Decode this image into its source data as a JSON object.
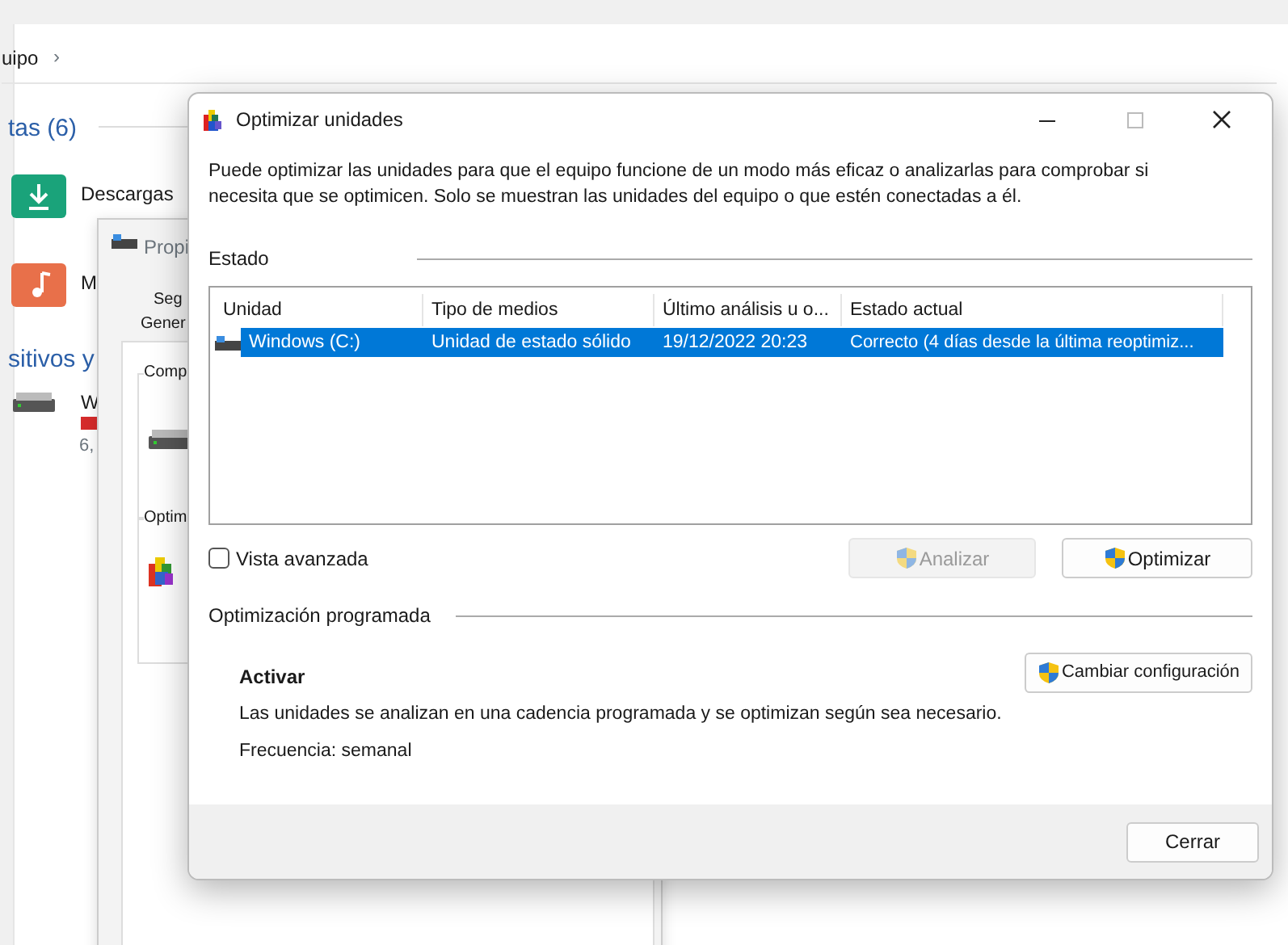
{
  "explorer": {
    "breadcrumb": "uipo",
    "breadcrumb_arrow": "›",
    "folders_heading": "tas (6)",
    "folders": [
      {
        "label": "Descargas",
        "kind": "downloads"
      },
      {
        "label": "M",
        "kind": "music"
      }
    ],
    "devices_heading": "sitivos y",
    "drive": {
      "label": "W",
      "size": "6,"
    }
  },
  "properties_window": {
    "title": "Propi",
    "tabs": [
      "Seg",
      "Gener"
    ],
    "groups": [
      "Comp",
      "Optim"
    ]
  },
  "dialog": {
    "title": "Optimizar unidades",
    "description": "Puede optimizar las unidades para que el equipo funcione de un modo más eficaz o analizarlas para comprobar si necesita que se optimicen. Solo se muestran las unidades del equipo o que estén conectadas a él.",
    "status_label": "Estado",
    "columns": [
      "Unidad",
      "Tipo de medios",
      "Último análisis u o...",
      "Estado actual"
    ],
    "drives": [
      {
        "name": "Windows (C:)",
        "media": "Unidad de estado sólido",
        "last_run": "19/12/2022 20:23",
        "status": "Correcto (4 días desde la última reoptimiz...",
        "selected": true
      }
    ],
    "advanced_view": {
      "label": "Vista avanzada",
      "checked": false
    },
    "buttons": [
      {
        "label": "Analizar",
        "disabled": true
      },
      {
        "label": "Optimizar",
        "disabled": false
      }
    ],
    "scheduled": {
      "label": "Optimización programada",
      "heading": "Activar",
      "description": "Las unidades se analizan en una cadencia programada y se optimizan según sea necesario.",
      "frequency": "Frecuencia: semanal",
      "button": "Cambiar configuración"
    },
    "close_button": "Cerrar"
  }
}
